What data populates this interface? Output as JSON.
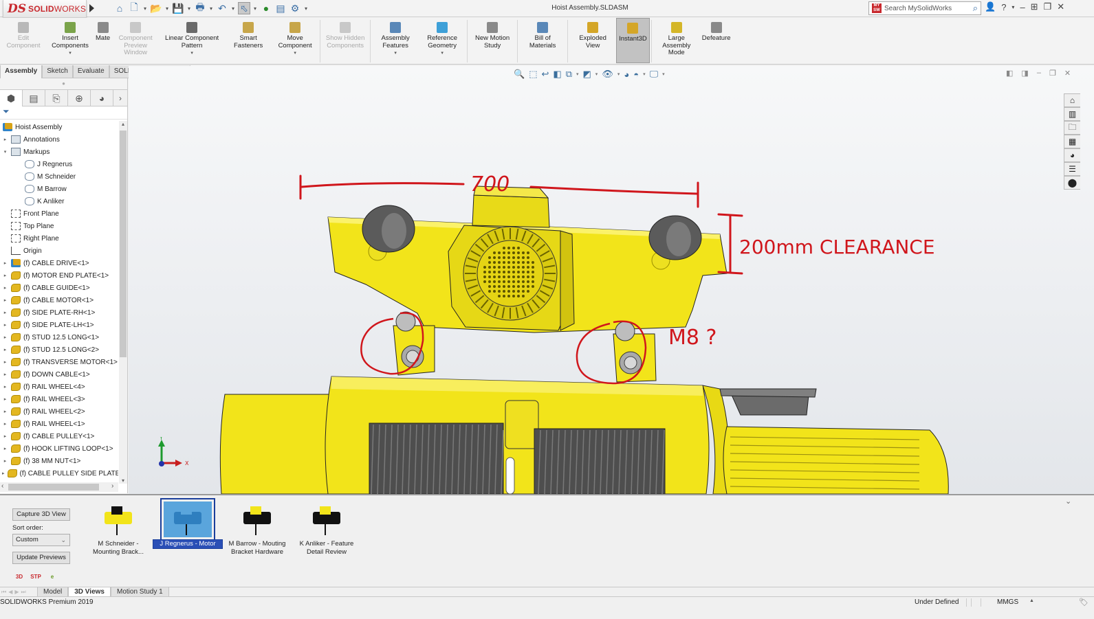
{
  "titlebar": {
    "brand_mark": "DS",
    "brand_name_bold": "SOLID",
    "brand_name_light": "WORKS",
    "document_title": "Hoist Assembly.SLDASM",
    "search_placeholder": "Search MySolidWorks",
    "search_badge": "MY SW",
    "help_label": "?",
    "quick_access": [
      {
        "name": "home-icon",
        "glyph": "⌂"
      },
      {
        "name": "new-document-icon",
        "glyph": "🗋"
      },
      {
        "name": "open-icon",
        "glyph": "📂"
      },
      {
        "name": "save-icon",
        "glyph": "💾"
      },
      {
        "name": "print-icon",
        "glyph": "🖶"
      },
      {
        "name": "undo-icon",
        "glyph": "↶"
      },
      {
        "name": "select-icon",
        "glyph": "⬁"
      },
      {
        "name": "rebuild-icon",
        "glyph": "●"
      },
      {
        "name": "file-properties-icon",
        "glyph": "▤"
      },
      {
        "name": "options-gear-icon",
        "glyph": "⚙"
      }
    ]
  },
  "ribbon": {
    "commands": [
      {
        "id": "edit-component",
        "label": "Edit Component",
        "disabled": true,
        "dropdown": false,
        "color": "#b8b8b8"
      },
      {
        "id": "insert-components",
        "label": "Insert Components",
        "disabled": false,
        "dropdown": true,
        "color": "#7aa34a"
      },
      {
        "id": "mate",
        "label": "Mate",
        "disabled": false,
        "dropdown": false,
        "color": "#8a8a8a"
      },
      {
        "id": "component-preview-window",
        "label": "Component Preview Window",
        "disabled": true,
        "dropdown": false,
        "color": "#c8c8c8"
      },
      {
        "id": "linear-component-pattern",
        "label": "Linear Component Pattern",
        "disabled": false,
        "dropdown": true,
        "color": "#6a6a6a"
      },
      {
        "id": "smart-fasteners",
        "label": "Smart Fasteners",
        "disabled": false,
        "dropdown": false,
        "color": "#c7a64a"
      },
      {
        "id": "move-component",
        "label": "Move Component",
        "disabled": false,
        "dropdown": true,
        "color": "#c7a64a"
      },
      {
        "id": "show-hidden-components",
        "label": "Show Hidden Components",
        "disabled": true,
        "dropdown": false,
        "color": "#c8c8c8"
      },
      {
        "id": "assembly-features",
        "label": "Assembly Features",
        "disabled": false,
        "dropdown": true,
        "color": "#5a88b8"
      },
      {
        "id": "reference-geometry",
        "label": "Reference Geometry",
        "disabled": false,
        "dropdown": true,
        "color": "#3ea0d8"
      },
      {
        "id": "new-motion-study",
        "label": "New Motion Study",
        "disabled": false,
        "dropdown": false,
        "color": "#8a8a8a"
      },
      {
        "id": "bill-of-materials",
        "label": "Bill of Materials",
        "disabled": false,
        "dropdown": false,
        "color": "#5a88b8"
      },
      {
        "id": "exploded-view",
        "label": "Exploded View",
        "disabled": false,
        "dropdown": false,
        "color": "#d4a628"
      },
      {
        "id": "instant3d",
        "label": "Instant3D",
        "disabled": false,
        "dropdown": false,
        "active": true,
        "color": "#d4a628"
      },
      {
        "id": "large-assembly-mode",
        "label": "Large Assembly Mode",
        "disabled": false,
        "dropdown": false,
        "color": "#d4b628"
      },
      {
        "id": "defeature",
        "label": "Defeature",
        "disabled": false,
        "dropdown": false,
        "color": "#8a8a8a"
      }
    ]
  },
  "command_tabs": [
    {
      "label": "Assembly",
      "active": true
    },
    {
      "label": "Sketch",
      "active": false
    },
    {
      "label": "Evaluate",
      "active": false
    },
    {
      "label": "SOLIDWORKS Add-Ins",
      "active": false
    }
  ],
  "feature_manager": {
    "tabs": [
      {
        "name": "featuremanager-tab",
        "glyph": "⬢",
        "active": true
      },
      {
        "name": "propertymanager-tab",
        "glyph": "▤",
        "active": false
      },
      {
        "name": "configurationmanager-tab",
        "glyph": "⎘",
        "active": false
      },
      {
        "name": "dimxpert-tab",
        "glyph": "⊕",
        "active": false
      },
      {
        "name": "displaymanager-tab",
        "glyph": "◕",
        "active": false
      }
    ],
    "filter_glyph": "⏷",
    "tree": [
      {
        "label": "Hoist Assembly",
        "icon": "asm",
        "indent": 0,
        "expander": ""
      },
      {
        "label": "Annotations",
        "icon": "folder",
        "indent": 1,
        "expander": "▸"
      },
      {
        "label": "Markups",
        "icon": "folder",
        "indent": 1,
        "expander": "▾"
      },
      {
        "label": "J Regnerus",
        "icon": "markup",
        "indent": 2,
        "expander": ""
      },
      {
        "label": "M Schneider",
        "icon": "markup",
        "indent": 2,
        "expander": ""
      },
      {
        "label": "M Barrow",
        "icon": "markup",
        "indent": 2,
        "expander": ""
      },
      {
        "label": "K Anliker",
        "icon": "markup",
        "indent": 2,
        "expander": ""
      },
      {
        "label": "Front Plane",
        "icon": "plane",
        "indent": 1,
        "expander": ""
      },
      {
        "label": "Top Plane",
        "icon": "plane",
        "indent": 1,
        "expander": ""
      },
      {
        "label": "Right Plane",
        "icon": "plane",
        "indent": 1,
        "expander": ""
      },
      {
        "label": "Origin",
        "icon": "origin",
        "indent": 1,
        "expander": ""
      },
      {
        "label": "(f) CABLE DRIVE<1>",
        "icon": "asm",
        "indent": 1,
        "expander": "▸"
      },
      {
        "label": "(f) MOTOR END PLATE<1>",
        "icon": "part",
        "indent": 1,
        "expander": "▸"
      },
      {
        "label": "(f) CABLE GUIDE<1>",
        "icon": "part",
        "indent": 1,
        "expander": "▸"
      },
      {
        "label": "(f) CABLE MOTOR<1>",
        "icon": "part",
        "indent": 1,
        "expander": "▸"
      },
      {
        "label": "(f) SIDE PLATE-RH<1>",
        "icon": "part",
        "indent": 1,
        "expander": "▸"
      },
      {
        "label": "(f) SIDE PLATE-LH<1>",
        "icon": "part",
        "indent": 1,
        "expander": "▸"
      },
      {
        "label": "(f) STUD 12.5 LONG<1>",
        "icon": "part",
        "indent": 1,
        "expander": "▸"
      },
      {
        "label": "(f) STUD 12.5 LONG<2>",
        "icon": "part",
        "indent": 1,
        "expander": "▸"
      },
      {
        "label": "(f) TRANSVERSE MOTOR<1>",
        "icon": "part",
        "indent": 1,
        "expander": "▸"
      },
      {
        "label": "(f) DOWN CABLE<1>",
        "icon": "part",
        "indent": 1,
        "expander": "▸"
      },
      {
        "label": "(f) RAIL WHEEL<4>",
        "icon": "part",
        "indent": 1,
        "expander": "▸"
      },
      {
        "label": "(f) RAIL WHEEL<3>",
        "icon": "part",
        "indent": 1,
        "expander": "▸"
      },
      {
        "label": "(f) RAIL WHEEL<2>",
        "icon": "part",
        "indent": 1,
        "expander": "▸"
      },
      {
        "label": "(f) RAIL WHEEL<1>",
        "icon": "part",
        "indent": 1,
        "expander": "▸"
      },
      {
        "label": "(f) CABLE PULLEY<1>",
        "icon": "part",
        "indent": 1,
        "expander": "▸"
      },
      {
        "label": "(f) HOOK LIFTING LOOP<1>",
        "icon": "part",
        "indent": 1,
        "expander": "▸"
      },
      {
        "label": "(f) 38 MM NUT<1>",
        "icon": "part",
        "indent": 1,
        "expander": "▸"
      },
      {
        "label": "(f) CABLE PULLEY SIDE PLATE<",
        "icon": "part",
        "indent": 1,
        "expander": "▸"
      }
    ]
  },
  "viewport": {
    "heads_up_toolbar": [
      {
        "name": "zoom-to-fit-icon",
        "glyph": "🔍",
        "dropdown": false
      },
      {
        "name": "zoom-to-area-icon",
        "glyph": "⬚",
        "dropdown": false
      },
      {
        "name": "previous-view-icon",
        "glyph": "↩",
        "dropdown": false
      },
      {
        "name": "section-view-icon",
        "glyph": "◧",
        "dropdown": false
      },
      {
        "name": "view-orientation-icon",
        "glyph": "⧉",
        "dropdown": true
      },
      {
        "name": "display-style-icon",
        "glyph": "◩",
        "dropdown": true
      },
      {
        "name": "hide-show-items-icon",
        "glyph": "👁",
        "dropdown": true
      },
      {
        "name": "edit-appearance-icon",
        "glyph": "◕",
        "dropdown": false
      },
      {
        "name": "apply-scene-icon",
        "glyph": "◓",
        "dropdown": true
      },
      {
        "name": "view-settings-icon",
        "glyph": "🖵",
        "dropdown": true
      }
    ],
    "task_pane": [
      {
        "name": "solidworks-resources-icon",
        "glyph": "⌂"
      },
      {
        "name": "design-library-icon",
        "glyph": "▥"
      },
      {
        "name": "file-explorer-icon",
        "glyph": "🗀"
      },
      {
        "name": "view-palette-icon",
        "glyph": "▦"
      },
      {
        "name": "appearances-scenes-icon",
        "glyph": "◕"
      },
      {
        "name": "custom-properties-icon",
        "glyph": "☰"
      },
      {
        "name": "solidworks-forum-icon",
        "glyph": "⬤"
      }
    ],
    "markup_annotations": [
      {
        "id": "width-dim",
        "text": "700"
      },
      {
        "id": "clearance",
        "text": "200mm CLEARANCE"
      },
      {
        "id": "bolt-question",
        "text": "M8 ?"
      }
    ],
    "triad": {
      "x_label": "X",
      "y_label": "Y"
    },
    "model_colors": {
      "body": "#f2e41a",
      "body_shade": "#c9ba0c",
      "steel": "#6a6a6a",
      "markup": "#d0161c"
    }
  },
  "views_pane": {
    "capture_button": "Capture 3D View",
    "sort_label": "Sort order:",
    "sort_value": "Custom",
    "update_button": "Update Previews",
    "views": [
      {
        "caption": "M Schneider - Mounting Brack...",
        "selected": false
      },
      {
        "caption": "J Regnerus - Motor",
        "selected": true
      },
      {
        "caption": "M Barrow - Mouting Bracket Hardware",
        "selected": false
      },
      {
        "caption": "K Anliker - Feature Detail Review",
        "selected": false
      }
    ],
    "export_icons": [
      {
        "name": "publish-3d-pdf-icon",
        "glyph": "3D"
      },
      {
        "name": "publish-step-icon",
        "glyph": "STP"
      },
      {
        "name": "publish-edrawings-icon",
        "glyph": "e"
      }
    ]
  },
  "bottom_tabs": [
    {
      "label": "Model",
      "active": false
    },
    {
      "label": "3D Views",
      "active": true
    },
    {
      "label": "Motion Study 1",
      "active": false
    }
  ],
  "statusbar": {
    "product": "SOLIDWORKS Premium 2019",
    "state": "Under Defined",
    "units": "MMGS"
  }
}
